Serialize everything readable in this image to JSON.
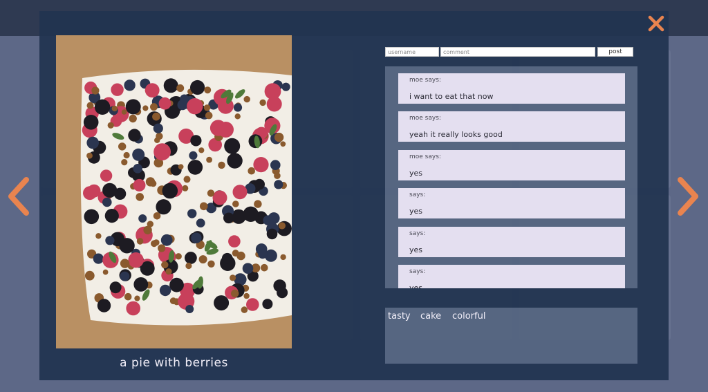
{
  "page": {
    "caption": "a pie with berries"
  },
  "photo": {
    "subject": "berry pie",
    "colors": {
      "parchment": "#b58c5e",
      "cream": "#f2eee6",
      "blueberry": "#2b3550",
      "blackberry": "#1d1b22",
      "raspberry": "#c8405b",
      "walnut": "#8a5a2e",
      "mint": "#4f7a3a"
    }
  },
  "comment_form": {
    "username_placeholder": "username",
    "comment_placeholder": "comment",
    "post_label": "post"
  },
  "comments": [
    {
      "author": "moe says:",
      "text": "i want to eat that now"
    },
    {
      "author": "moe says:",
      "text": "yeah it really looks good"
    },
    {
      "author": "moe says:",
      "text": "yes"
    },
    {
      "author": "says:",
      "text": "yes"
    },
    {
      "author": "says:",
      "text": "yes"
    },
    {
      "author": "says:",
      "text": "yes"
    }
  ],
  "tags": [
    "tasty",
    "cake",
    "colorful"
  ],
  "icons": {
    "close": "close-icon",
    "prev": "chevron-left-icon",
    "next": "chevron-right-icon"
  },
  "colors": {
    "accent": "#e9844f",
    "overlay": "#213450",
    "comment_bg": "#e4dff0"
  }
}
